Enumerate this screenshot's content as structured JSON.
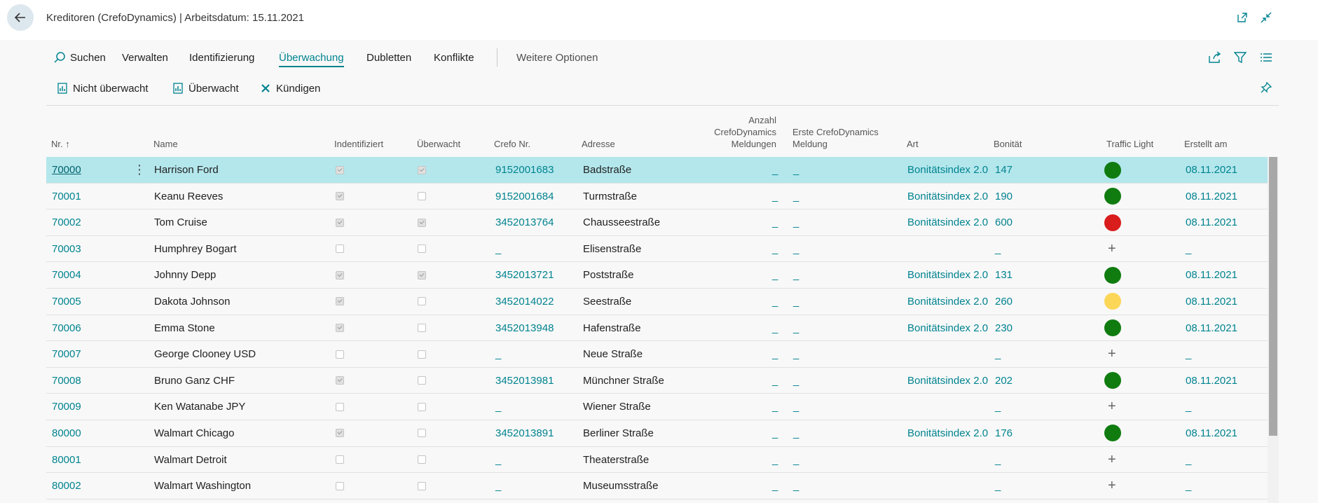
{
  "window": {
    "title": "Kreditoren (CrefoDynamics) | Arbeitsdatum: 15.11.2021"
  },
  "actions": {
    "search": "Suchen",
    "tabs": [
      "Verwalten",
      "Identifizierung",
      "Überwachung",
      "Dubletten",
      "Konflikte"
    ],
    "active_tab": "Überwachung",
    "more": "Weitere Optionen"
  },
  "subactions": {
    "not_monitored": "Nicht überwacht",
    "monitored": "Überwacht",
    "cancel": "Kündigen"
  },
  "columns": {
    "nr": "Nr. ↑",
    "name": "Name",
    "identified": "Indentifiziert",
    "monitored": "Überwacht",
    "crefo_nr": "Crefo Nr.",
    "address": "Adresse",
    "count_line1": "Anzahl",
    "count_line2": "CrefoDynamics",
    "count_line3": "Meldungen",
    "first_line1": "Erste CrefoDynamics",
    "first_line2": "Meldung",
    "type": "Art",
    "rating": "Bonität",
    "traffic_light": "Traffic Light",
    "created": "Erstellt am"
  },
  "colors": {
    "accent": "#00838f",
    "green": "#107c10",
    "red": "#d91c1c",
    "yellow": "#fcd657",
    "selected": "#b3e7ec"
  },
  "rows": [
    {
      "nr": "70000",
      "name": "Harrison Ford",
      "identified": true,
      "monitored": true,
      "crefo": "9152001683",
      "address": "Badstraße",
      "count": "_",
      "first": "_",
      "type": "Bonitätsindex 2.0",
      "rating": "147",
      "light": "green",
      "created": "08.11.2021",
      "selected": true
    },
    {
      "nr": "70001",
      "name": "Keanu Reeves",
      "identified": true,
      "monitored": false,
      "crefo": "9152001684",
      "address": "Turmstraße",
      "count": "_",
      "first": "_",
      "type": "Bonitätsindex 2.0",
      "rating": "190",
      "light": "green",
      "created": "08.11.2021"
    },
    {
      "nr": "70002",
      "name": "Tom Cruise",
      "identified": true,
      "monitored": true,
      "crefo": "3452013764",
      "address": "Chausseestraße",
      "count": "_",
      "first": "_",
      "type": "Bonitätsindex 2.0",
      "rating": "600",
      "light": "red",
      "created": "08.11.2021"
    },
    {
      "nr": "70003",
      "name": "Humphrey Bogart",
      "identified": false,
      "monitored": false,
      "crefo": "_",
      "address": "Elisenstraße",
      "count": "_",
      "first": "_",
      "type": "",
      "rating": "_",
      "light": "none",
      "created": "_"
    },
    {
      "nr": "70004",
      "name": "Johnny Depp",
      "identified": true,
      "monitored": true,
      "crefo": "3452013721",
      "address": "Poststraße",
      "count": "_",
      "first": "_",
      "type": "Bonitätsindex 2.0",
      "rating": "131",
      "light": "green",
      "created": "08.11.2021"
    },
    {
      "nr": "70005",
      "name": "Dakota Johnson",
      "identified": true,
      "monitored": false,
      "crefo": "3452014022",
      "address": "Seestraße",
      "count": "_",
      "first": "_",
      "type": "Bonitätsindex 2.0",
      "rating": "260",
      "light": "yellow",
      "created": "08.11.2021"
    },
    {
      "nr": "70006",
      "name": "Emma Stone",
      "identified": true,
      "monitored": false,
      "crefo": "3452013948",
      "address": "Hafenstraße",
      "count": "_",
      "first": "_",
      "type": "Bonitätsindex 2.0",
      "rating": "230",
      "light": "green",
      "created": "08.11.2021"
    },
    {
      "nr": "70007",
      "name": "George Clooney USD",
      "identified": false,
      "monitored": false,
      "crefo": "_",
      "address": "Neue Straße",
      "count": "_",
      "first": "_",
      "type": "",
      "rating": "_",
      "light": "none",
      "created": "_"
    },
    {
      "nr": "70008",
      "name": "Bruno Ganz CHF",
      "identified": true,
      "monitored": false,
      "crefo": "3452013981",
      "address": "Münchner Straße",
      "count": "_",
      "first": "_",
      "type": "Bonitätsindex 2.0",
      "rating": "202",
      "light": "green",
      "created": "08.11.2021"
    },
    {
      "nr": "70009",
      "name": "Ken Watanabe JPY",
      "identified": false,
      "monitored": false,
      "crefo": "_",
      "address": "Wiener Straße",
      "count": "_",
      "first": "_",
      "type": "",
      "rating": "_",
      "light": "none",
      "created": "_"
    },
    {
      "nr": "80000",
      "name": "Walmart Chicago",
      "identified": true,
      "monitored": false,
      "crefo": "3452013891",
      "address": "Berliner Straße",
      "count": "_",
      "first": "_",
      "type": "Bonitätsindex 2.0",
      "rating": "176",
      "light": "green",
      "created": "08.11.2021"
    },
    {
      "nr": "80001",
      "name": "Walmart Detroit",
      "identified": false,
      "monitored": false,
      "crefo": "_",
      "address": "Theaterstraße",
      "count": "_",
      "first": "_",
      "type": "",
      "rating": "_",
      "light": "none",
      "created": "_"
    },
    {
      "nr": "80002",
      "name": "Walmart Washington",
      "identified": false,
      "monitored": false,
      "crefo": "_",
      "address": "Museumsstraße",
      "count": "_",
      "first": "_",
      "type": "",
      "rating": "_",
      "light": "none",
      "created": "_"
    }
  ]
}
